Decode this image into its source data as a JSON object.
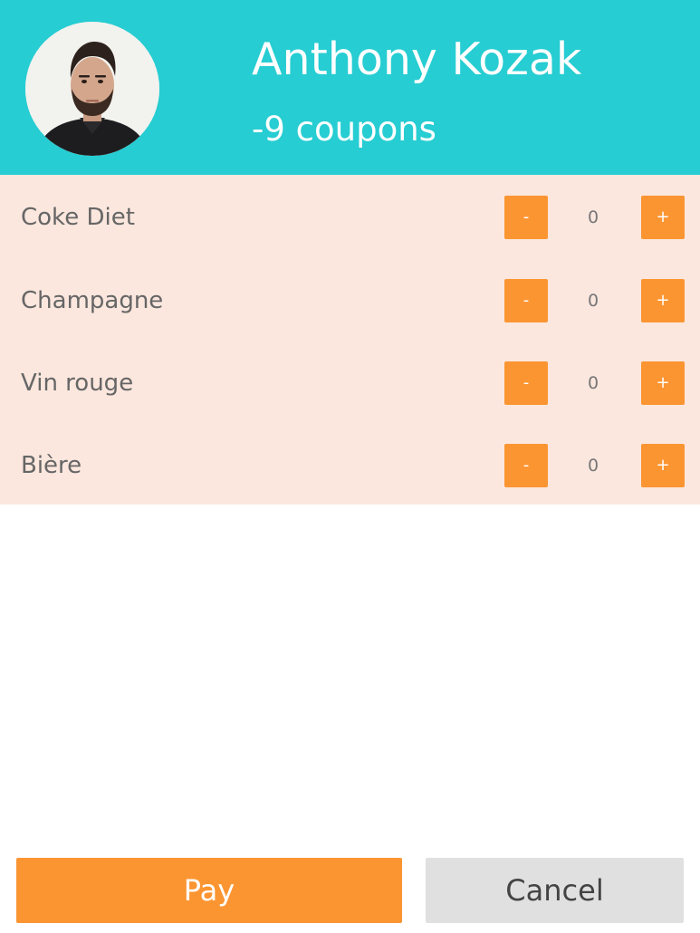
{
  "header": {
    "user_name": "Anthony Kozak",
    "coupons": "-9 coupons",
    "avatar_icon": "user-avatar-photo",
    "background_color": "#26cdd2"
  },
  "products": [
    {
      "name": "Coke Diet",
      "quantity": "0",
      "minus_label": "-",
      "plus_label": "+"
    },
    {
      "name": "Champagne",
      "quantity": "0",
      "minus_label": "-",
      "plus_label": "+"
    },
    {
      "name": "Vin rouge",
      "quantity": "0",
      "minus_label": "-",
      "plus_label": "+"
    },
    {
      "name": "Bière",
      "quantity": "0",
      "minus_label": "-",
      "plus_label": "+"
    }
  ],
  "actions": {
    "pay_label": "Pay",
    "cancel_label": "Cancel"
  },
  "colors": {
    "accent": "#fb9532",
    "list_background": "#fbe7de",
    "cancel_background": "#dfe0df"
  }
}
